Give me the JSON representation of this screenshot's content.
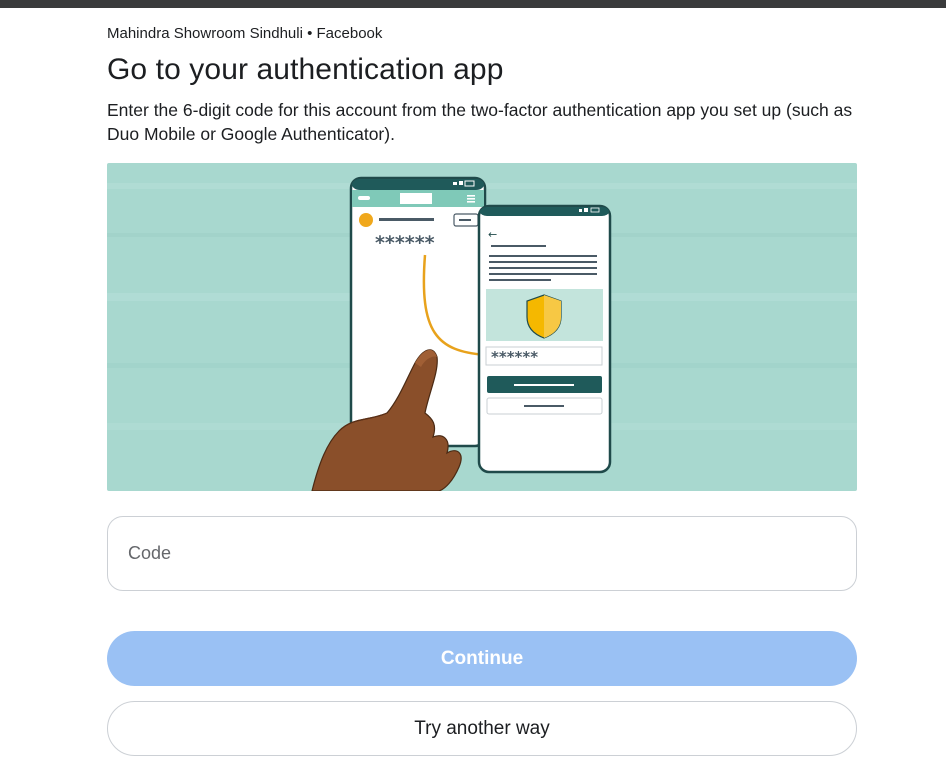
{
  "header": {
    "account_line": "Mahindra Showroom Sindhuli • Facebook",
    "title": "Go to your authentication app",
    "description": "Enter the 6-digit code for this account from the two-factor authentication app you set up (such as Duo Mobile or Google Authenticator)."
  },
  "illustration": {
    "phone_left_code": "******",
    "phone_right_code": "******"
  },
  "code_input": {
    "placeholder": "Code",
    "value": ""
  },
  "buttons": {
    "continue_label": "Continue",
    "try_another_label": "Try another way"
  },
  "colors": {
    "accent_disabled": "#9ac1f4",
    "illustration_bg": "#a8d8cf",
    "phone_header": "#1f5a5a",
    "shield": "#f5b800",
    "arrow": "#e8a21c"
  }
}
